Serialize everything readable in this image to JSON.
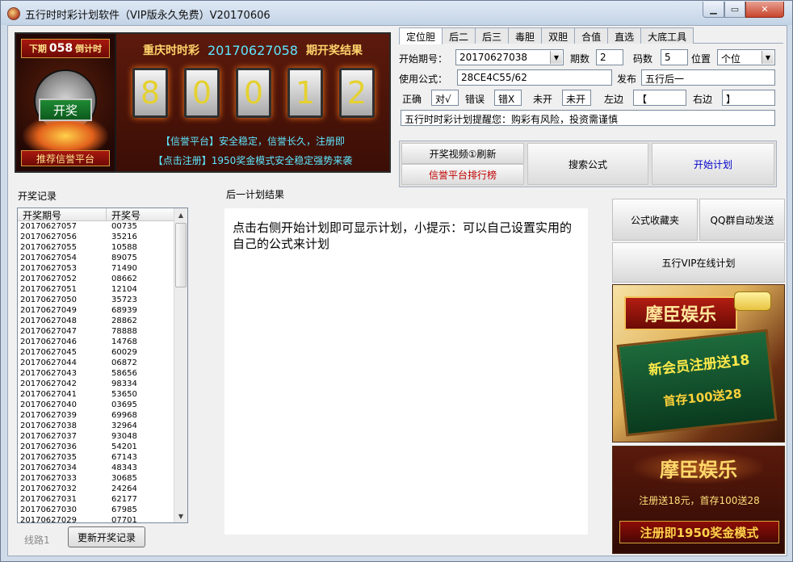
{
  "window": {
    "title": "五行时时彩计划软件（VIP版永久免费）V20170606"
  },
  "lottery": {
    "countdown_prefix": "下期",
    "countdown_issue": "058",
    "countdown_suffix": "倒计时",
    "open_label": "开奖",
    "recommend_label": "推荐信誉平台",
    "name": "重庆时时彩",
    "issue": "20170627058",
    "issue_suffix": "期开奖结果",
    "digits": [
      "8",
      "0",
      "0",
      "1",
      "2"
    ],
    "notice_line1": "【信誉平台】安全稳定，信誉长久，注册即",
    "notice_line2": "【点击注册】1950奖金模式安全稳定强势来袭"
  },
  "tabs": [
    "定位胆",
    "后二",
    "后三",
    "毒胆",
    "双胆",
    "合值",
    "直选",
    "大底工具"
  ],
  "form": {
    "start_issue_label": "开始期号：",
    "start_issue_value": "20170627038",
    "periods_label": "期数",
    "periods_value": "2",
    "codes_label": "码数",
    "codes_value": "5",
    "position_label": "位置",
    "position_value": "个位",
    "formula_label": "使用公式：",
    "formula_value": "28CE4C55/62",
    "publish_label": "发布",
    "publish_value": "五行后一",
    "correct_label": "正确",
    "correct_value": "对√",
    "wrong_label": "错误",
    "wrong_value": "错X",
    "notopen_label": "未开",
    "notopen_value": "未开",
    "left_label": "左边",
    "left_value": "【",
    "right_label": "右边",
    "right_value": "】",
    "reminder": "五行时时彩计划提醒您：购彩有风险，投资需谨慎"
  },
  "actions": {
    "video_refresh": "开奖视频①刷新",
    "platform_rank": "信誉平台排行榜",
    "search_formula": "搜索公式",
    "start_plan": "开始计划"
  },
  "records": {
    "section_label": "开奖记录",
    "col_issue": "开奖期号",
    "col_number": "开奖号",
    "rows": [
      [
        "20170627057",
        "00735"
      ],
      [
        "20170627056",
        "35216"
      ],
      [
        "20170627055",
        "10588"
      ],
      [
        "20170627054",
        "89075"
      ],
      [
        "20170627053",
        "71490"
      ],
      [
        "20170627052",
        "08662"
      ],
      [
        "20170627051",
        "12104"
      ],
      [
        "20170627050",
        "35723"
      ],
      [
        "20170627049",
        "68939"
      ],
      [
        "20170627048",
        "28862"
      ],
      [
        "20170627047",
        "78888"
      ],
      [
        "20170627046",
        "14768"
      ],
      [
        "20170627045",
        "60029"
      ],
      [
        "20170627044",
        "06872"
      ],
      [
        "20170627043",
        "58656"
      ],
      [
        "20170627042",
        "98334"
      ],
      [
        "20170627041",
        "53650"
      ],
      [
        "20170627040",
        "03695"
      ],
      [
        "20170627039",
        "69968"
      ],
      [
        "20170627038",
        "32964"
      ],
      [
        "20170627037",
        "93048"
      ],
      [
        "20170627036",
        "54201"
      ],
      [
        "20170627035",
        "67143"
      ],
      [
        "20170627034",
        "48343"
      ],
      [
        "20170627033",
        "30685"
      ],
      [
        "20170627032",
        "24264"
      ],
      [
        "20170627031",
        "62177"
      ],
      [
        "20170627030",
        "67985"
      ],
      [
        "20170627029",
        "07701"
      ]
    ],
    "line_label": "线路1",
    "update_button": "更新开奖记录"
  },
  "result": {
    "section_label": "后一计划结果",
    "text": "点击右侧开始计划即可显示计划，小提示：可以自己设置实用的自己的公式来计划"
  },
  "side": {
    "favorites": "公式收藏夹",
    "qq_send": "QQ群自动发送",
    "vip_online": "五行VIP在线计划"
  },
  "ads": {
    "ad1_title": "摩臣娱乐",
    "ad1_line1": "新会员注册送18",
    "ad1_line2": "首存100送28",
    "ad2_title": "摩臣娱乐",
    "ad2_line1": "注册送18元，首存100送28",
    "ad2_line2": "注册即1950奖金模式"
  }
}
